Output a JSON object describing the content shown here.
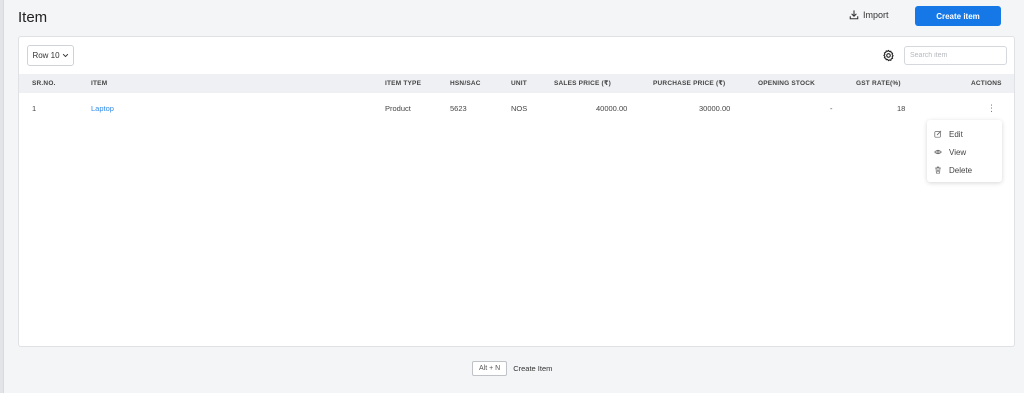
{
  "header": {
    "title": "Item",
    "import_label": "Import",
    "create_label": "Create item"
  },
  "toolbar": {
    "rows_label": "Row 10",
    "search_placeholder": "Search item"
  },
  "table": {
    "columns": [
      "SR.NO.",
      "ITEM",
      "ITEM TYPE",
      "HSN/SAC",
      "UNIT",
      "SALES PRICE (₹)",
      "PURCHASE PRICE (₹)",
      "OPENING STOCK",
      "GST RATE(%)",
      "ACTIONS"
    ],
    "rows": [
      {
        "sr_no": "1",
        "item": "Laptop",
        "item_type": "Product",
        "hsn_sac": "5623",
        "unit": "NOS",
        "sales_price": "40000.00",
        "purchase_price": "30000.00",
        "opening_stock": "-",
        "gst_rate": "18"
      }
    ]
  },
  "actions_menu": {
    "items": [
      {
        "label": "Edit",
        "icon": "edit-icon"
      },
      {
        "label": "View",
        "icon": "eye-icon"
      },
      {
        "label": "Delete",
        "icon": "trash-icon"
      }
    ]
  },
  "footer": {
    "shortcut_key": "Alt + N",
    "shortcut_label": "Create Item"
  },
  "colors": {
    "accent": "#1678e6",
    "link": "#2f8ae8",
    "header_bg": "#eef0f3",
    "page_bg": "#f4f5f7"
  }
}
